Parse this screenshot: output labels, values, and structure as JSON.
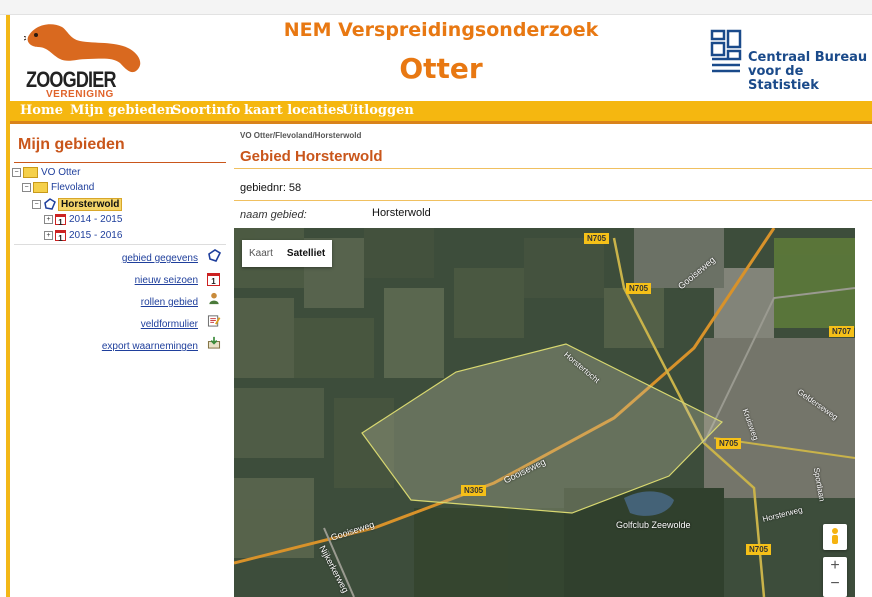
{
  "header": {
    "title": "NEM Verspreidingsonderzoek",
    "subtitle": "Otter",
    "logo_left_text": "ZOOGDIER",
    "logo_left_sub": "VERENIGING",
    "logo_right_line1": "Centraal Bureau",
    "logo_right_line2": "voor de Statistiek"
  },
  "nav": {
    "items": [
      "Home",
      "Mijn gebieden",
      "Soortinfo",
      "kaart locaties",
      "Uitloggen"
    ]
  },
  "sidebar": {
    "title": "Mijn gebieden",
    "tree": {
      "root": "VO Otter",
      "province": "Flevoland",
      "area": "Horsterwold",
      "seasons": [
        "2014 - 2015",
        "2015 - 2016"
      ],
      "cal_glyph": "1"
    },
    "actions": [
      "gebied gegevens",
      "nieuw seizoen",
      "rollen gebied",
      "veldformulier",
      "export waarnemingen"
    ]
  },
  "main": {
    "breadcrumb": "VO Otter/Flevoland/Horsterwold",
    "title": "Gebied Horsterwold",
    "gebiednr": "gebiednr: 58",
    "naam_label": "naam gebied:",
    "naam_value": "Horsterwold"
  },
  "map": {
    "type_buttons": [
      "Kaart",
      "Satelliet"
    ],
    "selected_type": "Satelliet",
    "zoom_in": "+",
    "zoom_out": "−",
    "labels": {
      "n705": "N705",
      "n707": "N707",
      "n305": "N305",
      "gooiseweg": "Gooiseweg",
      "horstertocht": "Horstertocht",
      "golfclub": "Golfclub Zeewolde",
      "nijkerkerweg": "Nijkerkerweg",
      "horsterweg": "Horsterweg",
      "gelderseweg": "Gelderseweg",
      "kruisweg": "Kruisweg",
      "sportlaan": "Sportlaan"
    }
  },
  "colors": {
    "accent": "#f5b710",
    "title": "#e87812",
    "heading": "#c9561b",
    "link": "#1f3f9c"
  }
}
